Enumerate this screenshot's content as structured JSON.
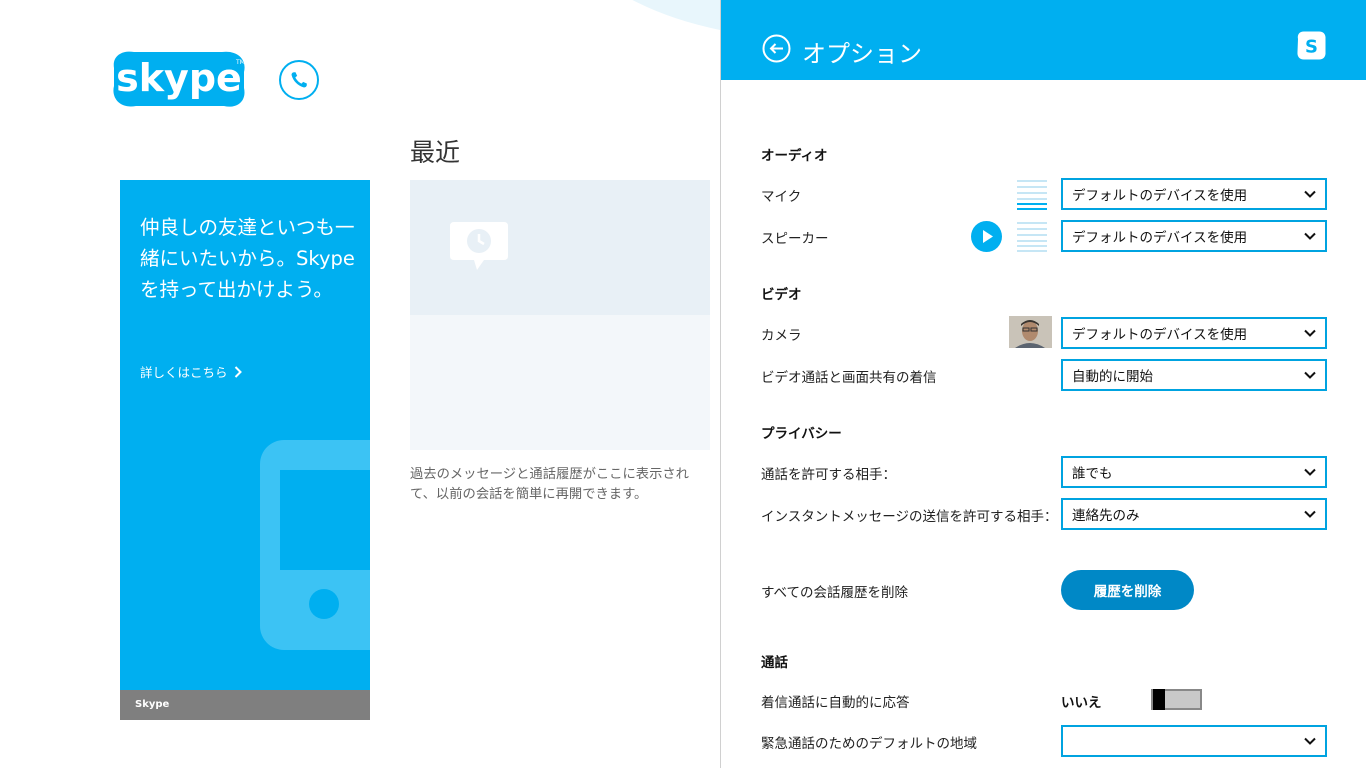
{
  "app": {
    "logo_text": "skype",
    "recent_title": "最近",
    "recent_description": "過去のメッセージと通話履歴がここに表示されて、以前の会話を簡単に再開できます。",
    "promo": {
      "text": "仲良しの友達といつも一緒にいたいから。Skypeを持って出かけよう。",
      "link": "詳しくはこちら",
      "footer": "Skype"
    }
  },
  "options": {
    "title": "オプション",
    "audio": {
      "heading": "オーディオ",
      "mic_label": "マイク",
      "mic_value": "デフォルトのデバイスを使用",
      "speaker_label": "スピーカー",
      "speaker_value": "デフォルトのデバイスを使用"
    },
    "video": {
      "heading": "ビデオ",
      "camera_label": "カメラ",
      "camera_value": "デフォルトのデバイスを使用",
      "incoming_label": "ビデオ通話と画面共有の着信",
      "incoming_value": "自動的に開始"
    },
    "privacy": {
      "heading": "プライバシー",
      "calls_label": "通話を許可する相手：",
      "calls_value": "誰でも",
      "im_label": "インスタントメッセージの送信を許可する相手：",
      "im_value": "連絡先のみ",
      "delete_label": "すべての会話履歴を削除",
      "delete_button": "履歴を削除"
    },
    "calls": {
      "heading": "通話",
      "auto_answer_label": "着信通話に自動的に応答",
      "auto_answer_value": "いいえ",
      "emergency_label": "緊急通話のためのデフォルトの地域",
      "emergency_value": ""
    }
  },
  "colors": {
    "accent": "#00aff0",
    "dark_accent": "#0088c6"
  },
  "icons": [
    "skype-logo",
    "phone-icon",
    "chevron-right-icon",
    "back-arrow-icon",
    "chevron-down-icon",
    "play-icon",
    "chat-clock-icon"
  ]
}
